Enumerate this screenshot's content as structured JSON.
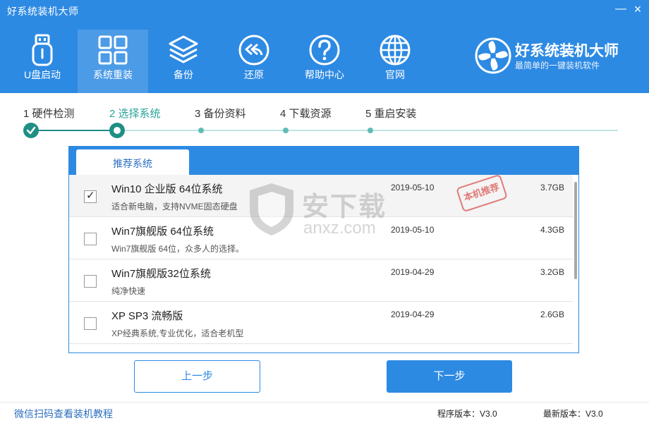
{
  "app": {
    "title": "好系统装机大师",
    "minimize": "—",
    "close": "×"
  },
  "nav": {
    "items": [
      {
        "label": "U盘启动",
        "icon": "usb-drive-icon"
      },
      {
        "label": "系统重装",
        "icon": "windows-grid-icon",
        "active": true
      },
      {
        "label": "备份",
        "icon": "layers-icon"
      },
      {
        "label": "还原",
        "icon": "restore-arrows-icon"
      },
      {
        "label": "帮助中心",
        "icon": "help-question-icon"
      },
      {
        "label": "官网",
        "icon": "globe-icon"
      }
    ]
  },
  "brand": {
    "name": "好系统装机大师",
    "slogan": "最简单的一键装机软件"
  },
  "steps": [
    {
      "label": "1 硬件检测",
      "state": "done"
    },
    {
      "label": "2 选择系统",
      "state": "current"
    },
    {
      "label": "3 备份资料",
      "state": "pending"
    },
    {
      "label": "4 下载资源",
      "state": "pending"
    },
    {
      "label": "5 重启安装",
      "state": "pending"
    }
  ],
  "panel": {
    "tab": "推荐系统",
    "stamp": "本机推荐",
    "rows": [
      {
        "name": "Win10 企业版 64位系统",
        "desc": "适合新电脑，支持NVME固态硬盘",
        "date": "2019-05-10",
        "size": "3.7GB",
        "checked": true
      },
      {
        "name": "Win7旗舰版 64位系统",
        "desc": "Win7旗舰版 64位，众多人的选择。",
        "date": "2019-05-10",
        "size": "4.3GB",
        "checked": false
      },
      {
        "name": "Win7旗舰版32位系统",
        "desc": "纯净快速",
        "date": "2019-04-29",
        "size": "3.2GB",
        "checked": false
      },
      {
        "name": "XP SP3 流畅版",
        "desc": "XP经典系统,专业优化，适合老机型",
        "date": "2019-04-29",
        "size": "2.6GB",
        "checked": false
      }
    ]
  },
  "watermark": {
    "text": "安下载",
    "url": "anxz.com"
  },
  "buttons": {
    "prev": "上一步",
    "next": "下一步"
  },
  "footer": {
    "link": "微信扫码查看装机教程",
    "program_version": "程序版本：V3.0",
    "latest_version": "最新版本：V3.0"
  },
  "colors": {
    "primary": "#2d8ae3",
    "step_done": "#1f8f84",
    "step_pending": "#5fbdb5",
    "stamp": "#d9534f"
  }
}
